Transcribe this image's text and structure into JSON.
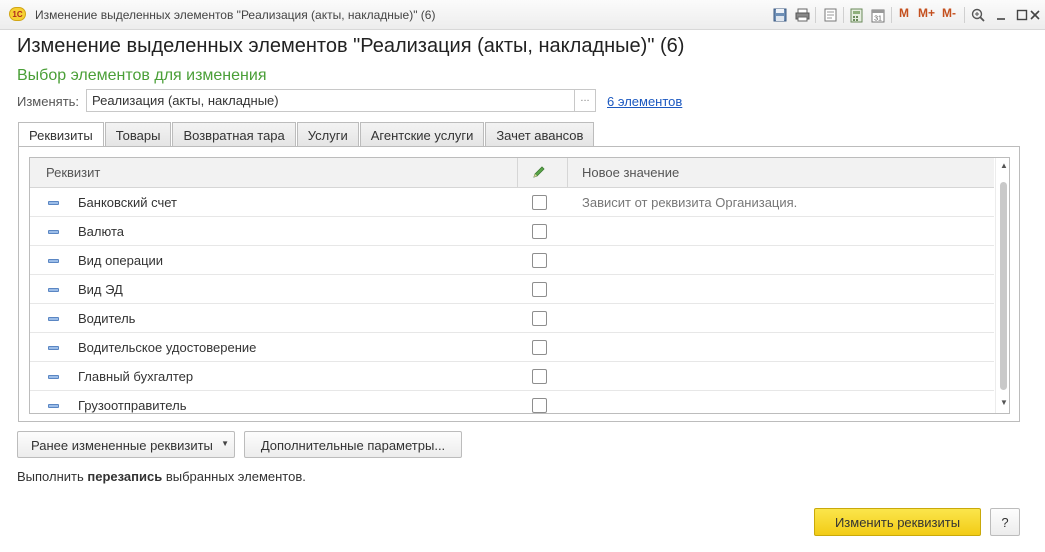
{
  "window": {
    "title": "Изменение выделенных элементов \"Реализация (акты, накладные)\" (6)",
    "logo_text": "1С",
    "toolbar_icons": [
      "save-icon",
      "print-icon",
      "print-preview-icon",
      "calculator-icon",
      "calendar-icon",
      "memory-m-icon",
      "memory-plus-icon",
      "memory-minus-icon",
      "zoom-icon",
      "minimize-icon",
      "maximize-icon",
      "close-icon"
    ],
    "memory_labels": [
      "M",
      "M+",
      "M-"
    ]
  },
  "form": {
    "title": "Изменение выделенных элементов \"Реализация (акты, накладные)\" (6)",
    "section_title": "Выбор элементов для изменения",
    "change_label": "Изменять:",
    "change_value": "Реализация (акты, накладные)",
    "choose_button": "...",
    "elements_link": "6 элементов"
  },
  "tabs": [
    {
      "label": "Реквизиты",
      "active": true
    },
    {
      "label": "Товары",
      "active": false
    },
    {
      "label": "Возвратная тара",
      "active": false
    },
    {
      "label": "Услуги",
      "active": false
    },
    {
      "label": "Агентские услуги",
      "active": false
    },
    {
      "label": "Зачет авансов",
      "active": false
    }
  ],
  "table": {
    "columns": {
      "attribute": "Реквизит",
      "edit_icon": "pencil-icon",
      "new_value": "Новое значение"
    },
    "rows": [
      {
        "name": "Банковский счет",
        "checked": false,
        "value": "Зависит от реквизита Организация."
      },
      {
        "name": "Валюта",
        "checked": false,
        "value": ""
      },
      {
        "name": "Вид операции",
        "checked": false,
        "value": ""
      },
      {
        "name": "Вид ЭД",
        "checked": false,
        "value": ""
      },
      {
        "name": "Водитель",
        "checked": false,
        "value": ""
      },
      {
        "name": "Водительское удостоверение",
        "checked": false,
        "value": ""
      },
      {
        "name": "Главный бухгалтер",
        "checked": false,
        "value": ""
      },
      {
        "name": "Грузоотправитель",
        "checked": false,
        "value": ""
      }
    ]
  },
  "buttons": {
    "previous_attrs": "Ранее измененные реквизиты",
    "additional_params": "Дополнительные параметры...",
    "change_attrs": "Изменить реквизиты",
    "help": "?"
  },
  "status": {
    "prefix": "Выполнить ",
    "bold": "перезапись",
    "suffix": " выбранных элементов."
  },
  "colors": {
    "section_title": "#4a9f37",
    "link": "#1b58c0",
    "primary_button": "#f2cc16"
  }
}
